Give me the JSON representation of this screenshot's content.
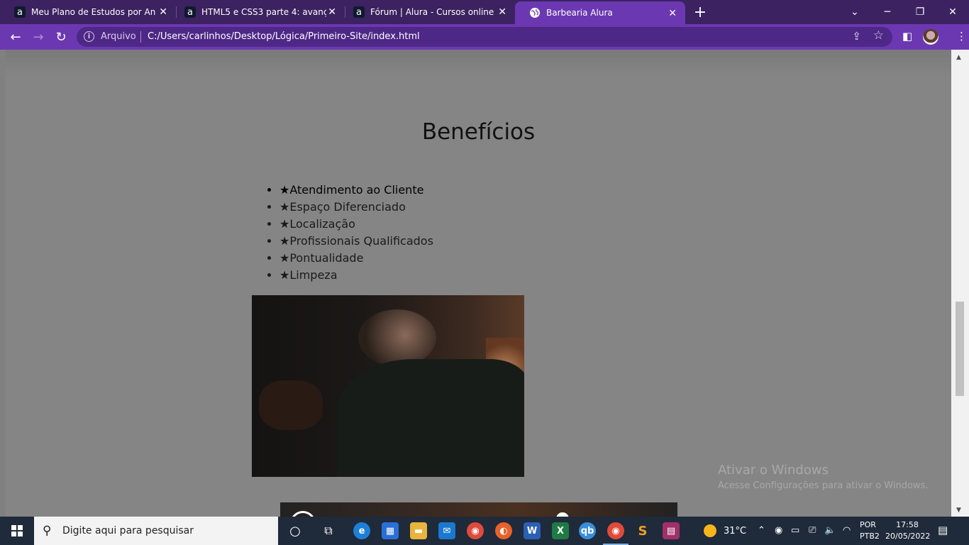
{
  "browser": {
    "tabs": [
      {
        "title": "Meu Plano de Estudos por Anna",
        "favicon": "alura-a-icon"
      },
      {
        "title": "HTML5 e CSS3 parte 4: avançand",
        "favicon": "alura-a-icon"
      },
      {
        "title": "Fórum | Alura - Cursos online de",
        "favicon": "alura-a-icon"
      },
      {
        "title": "Barbearia Alura",
        "favicon": "globe-icon",
        "active": true
      }
    ],
    "address": {
      "scheme_label": "Arquivo",
      "url": "C:/Users/carlinhos/Desktop/Lógica/Primeiro-Site/index.html"
    },
    "accent_color": "#6b38b2",
    "tabstrip_color": "#3c2260"
  },
  "page": {
    "heading": "Benefícios",
    "benefits": [
      "★Atendimento ao Cliente",
      "★Espaço Diferenciado",
      "★Localização",
      "★Profissionais Qualificados",
      "★Pontualidade",
      "★Limpeza"
    ],
    "background_color": "#858585"
  },
  "watermark": {
    "title": "Ativar o Windows",
    "subtitle": "Acesse Configurações para ativar o Windows."
  },
  "taskbar": {
    "search_placeholder": "Digite aqui para pesquisar",
    "weather": "31°C",
    "lang_line1": "POR",
    "lang_line2": "PTB2",
    "time": "17:58",
    "date": "20/05/2022"
  }
}
